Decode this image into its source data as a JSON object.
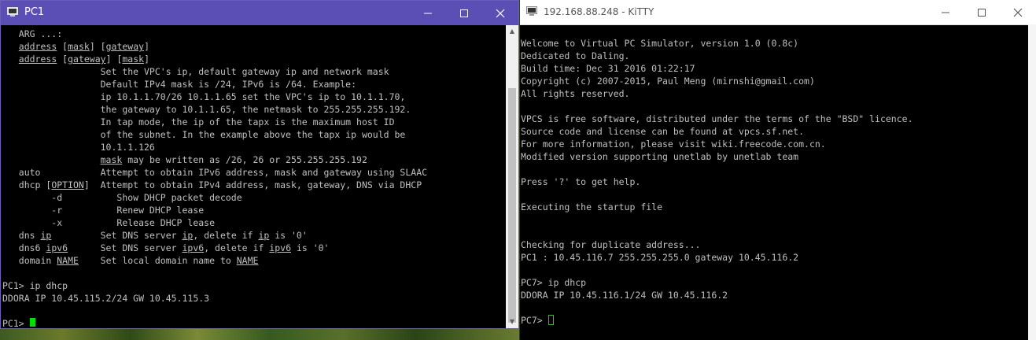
{
  "pc1": {
    "title": "PC1",
    "lines": [
      {
        "segs": [
          {
            "t": "   ARG ...:"
          }
        ]
      },
      {
        "segs": [
          {
            "t": "   "
          },
          {
            "t": "address",
            "u": true
          },
          {
            "t": " ["
          },
          {
            "t": "mask",
            "u": true
          },
          {
            "t": "] ["
          },
          {
            "t": "gateway",
            "u": true
          },
          {
            "t": "]"
          }
        ]
      },
      {
        "segs": [
          {
            "t": "   "
          },
          {
            "t": "address",
            "u": true
          },
          {
            "t": " ["
          },
          {
            "t": "gateway",
            "u": true
          },
          {
            "t": "] ["
          },
          {
            "t": "mask",
            "u": true
          },
          {
            "t": "]"
          }
        ]
      },
      {
        "segs": [
          {
            "t": "                  Set the VPC's ip, default gateway ip and network mask"
          }
        ]
      },
      {
        "segs": [
          {
            "t": "                  Default IPv4 mask is /24, IPv6 is /64. Example:"
          }
        ]
      },
      {
        "segs": [
          {
            "t": "                  ip 10.1.1.70/26 10.1.1.65 set the VPC's ip to 10.1.1.70,"
          }
        ]
      },
      {
        "segs": [
          {
            "t": "                  the gateway to 10.1.1.65, the netmask to 255.255.255.192."
          }
        ]
      },
      {
        "segs": [
          {
            "t": "                  In tap mode, the ip of the tapx is the maximum host ID"
          }
        ]
      },
      {
        "segs": [
          {
            "t": "                  of the subnet. In the example above the tapx ip would be"
          }
        ]
      },
      {
        "segs": [
          {
            "t": "                  10.1.1.126"
          }
        ]
      },
      {
        "segs": [
          {
            "t": "                  "
          },
          {
            "t": "mask",
            "u": true
          },
          {
            "t": " may be written as /26, 26 or 255.255.255.192"
          }
        ]
      },
      {
        "segs": [
          {
            "t": "   auto           Attempt to obtain IPv6 address, mask and gateway using SLAAC"
          }
        ]
      },
      {
        "segs": [
          {
            "t": "   dhcp ["
          },
          {
            "t": "OPTION",
            "u": true
          },
          {
            "t": "]  Attempt to obtain IPv4 address, mask, gateway, DNS via DHCP"
          }
        ]
      },
      {
        "segs": [
          {
            "t": "         -d          Show DHCP packet decode"
          }
        ]
      },
      {
        "segs": [
          {
            "t": "         -r          Renew DHCP lease"
          }
        ]
      },
      {
        "segs": [
          {
            "t": "         -x          Release DHCP lease"
          }
        ]
      },
      {
        "segs": [
          {
            "t": "   dns "
          },
          {
            "t": "ip",
            "u": true
          },
          {
            "t": "         Set DNS server "
          },
          {
            "t": "ip",
            "u": true
          },
          {
            "t": ", delete if "
          },
          {
            "t": "ip",
            "u": true
          },
          {
            "t": " is '0'"
          }
        ]
      },
      {
        "segs": [
          {
            "t": "   dns6 "
          },
          {
            "t": "ipv6",
            "u": true
          },
          {
            "t": "      Set DNS server "
          },
          {
            "t": "ipv6",
            "u": true
          },
          {
            "t": ", delete if "
          },
          {
            "t": "ipv6",
            "u": true
          },
          {
            "t": " is '0'"
          }
        ]
      },
      {
        "segs": [
          {
            "t": "   domain "
          },
          {
            "t": "NAME",
            "u": true
          },
          {
            "t": "    Set local domain name to "
          },
          {
            "t": "NAME",
            "u": true
          }
        ]
      },
      {
        "segs": [
          {
            "t": ""
          }
        ]
      },
      {
        "segs": [
          {
            "t": "PC1> ip dhcp"
          }
        ]
      },
      {
        "segs": [
          {
            "t": "DDORA IP 10.45.115.2/24 GW 10.45.115.3"
          }
        ]
      },
      {
        "segs": [
          {
            "t": ""
          }
        ]
      },
      {
        "segs": [
          {
            "t": "PC1> "
          }
        ],
        "cursor": "solid"
      }
    ]
  },
  "kitty": {
    "title": "192.168.88.248 - KiTTY",
    "lines": [
      {
        "segs": [
          {
            "t": "Welcome to Virtual PC Simulator, version 1.0 (0.8c)"
          }
        ]
      },
      {
        "segs": [
          {
            "t": "Dedicated to Daling."
          }
        ]
      },
      {
        "segs": [
          {
            "t": "Build time: Dec 31 2016 01:22:17"
          }
        ]
      },
      {
        "segs": [
          {
            "t": "Copyright (c) 2007-2015, Paul Meng (mirnshi@gmail.com)"
          }
        ]
      },
      {
        "segs": [
          {
            "t": "All rights reserved."
          }
        ]
      },
      {
        "segs": [
          {
            "t": ""
          }
        ]
      },
      {
        "segs": [
          {
            "t": "VPCS is free software, distributed under the terms of the \"BSD\" licence."
          }
        ]
      },
      {
        "segs": [
          {
            "t": "Source code and license can be found at vpcs.sf.net."
          }
        ]
      },
      {
        "segs": [
          {
            "t": "For more information, please visit wiki.freecode.com.cn."
          }
        ]
      },
      {
        "segs": [
          {
            "t": "Modified version supporting unetlab by unetlab team"
          }
        ]
      },
      {
        "segs": [
          {
            "t": ""
          }
        ]
      },
      {
        "segs": [
          {
            "t": "Press '?' to get help."
          }
        ]
      },
      {
        "segs": [
          {
            "t": ""
          }
        ]
      },
      {
        "segs": [
          {
            "t": "Executing the startup file"
          }
        ]
      },
      {
        "segs": [
          {
            "t": ""
          }
        ]
      },
      {
        "segs": [
          {
            "t": ""
          }
        ]
      },
      {
        "segs": [
          {
            "t": "Checking for duplicate address..."
          }
        ]
      },
      {
        "segs": [
          {
            "t": "PC1 : 10.45.116.7 255.255.255.0 gateway 10.45.116.2"
          }
        ]
      },
      {
        "segs": [
          {
            "t": ""
          }
        ]
      },
      {
        "segs": [
          {
            "t": "PC7> ip dhcp"
          }
        ]
      },
      {
        "segs": [
          {
            "t": "DDORA IP 10.45.116.1/24 GW 10.45.116.2"
          }
        ]
      },
      {
        "segs": [
          {
            "t": ""
          }
        ]
      },
      {
        "segs": [
          {
            "t": "PC7> "
          }
        ],
        "cursor": "hollow"
      }
    ]
  },
  "icons": {
    "minimize": "minimize-icon",
    "maximize": "maximize-icon",
    "close": "close-icon",
    "app": "terminal-app-icon"
  }
}
